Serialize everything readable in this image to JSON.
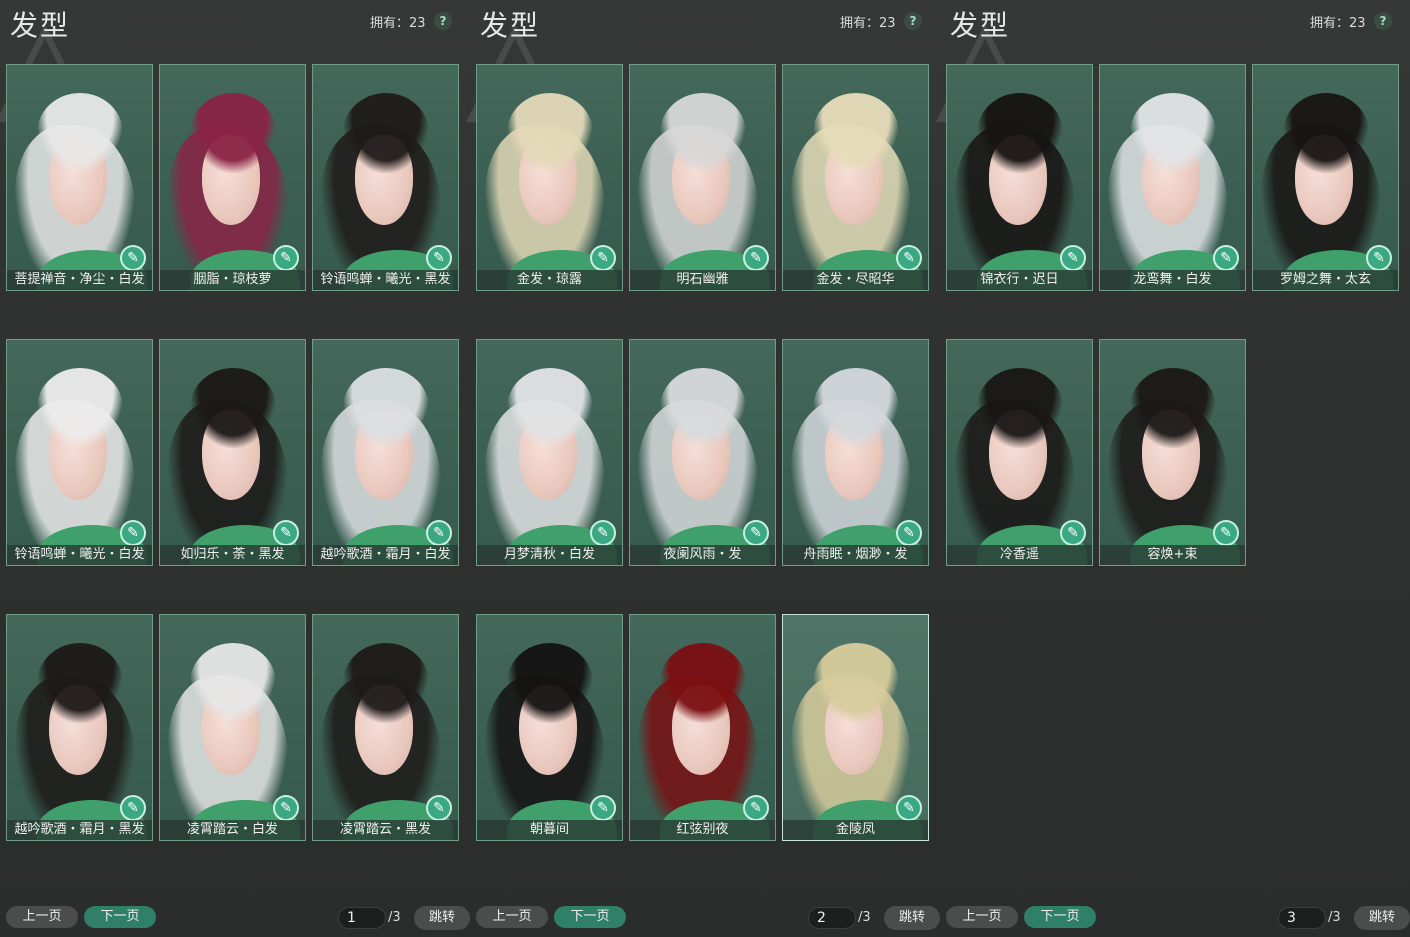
{
  "colors": {
    "card_bg": "#3f6357",
    "card_border": "#6e9d8a",
    "accent": "#2f8066",
    "dye_button": "#3aa882"
  },
  "panels": [
    {
      "title": "发型",
      "owned_label": "拥有：23",
      "help": "?",
      "items": [
        {
          "label": "菩提禅音・净尘・白发",
          "hair": "#e8e8e8",
          "selected": false
        },
        {
          "label": "胭脂・琼枝萝",
          "hair": "#8a2346",
          "selected": false
        },
        {
          "label": "铃语鸣蝉・曦光・黑发",
          "hair": "#1f1a1a",
          "selected": false
        },
        {
          "label": "铃语鸣蝉・曦光・白发",
          "hair": "#ececec",
          "selected": false
        },
        {
          "label": "如归乐・荼・黑发",
          "hair": "#1c1818",
          "selected": false
        },
        {
          "label": "越吟歌酒・霜月・白发",
          "hair": "#dcdfe2",
          "selected": false
        },
        {
          "label": "越吟歌酒・霜月・黑发",
          "hair": "#1d1919",
          "selected": false
        },
        {
          "label": "凌霄踏云・白发",
          "hair": "#e6e6e6",
          "selected": false
        },
        {
          "label": "凌霄踏云・黑发",
          "hair": "#1e1a1a",
          "selected": false
        }
      ],
      "prev_label": "上一页",
      "next_label": "下一页",
      "page": "1",
      "total": "/3",
      "jump_label": "跳转"
    },
    {
      "title": "发型",
      "owned_label": "拥有：23",
      "help": "?",
      "items": [
        {
          "label": "金发・琼露",
          "hair": "#e3d9b8",
          "selected": false
        },
        {
          "label": "明石幽雅",
          "hair": "#d8d8d8",
          "selected": false
        },
        {
          "label": "金发・尽昭华",
          "hair": "#e6dcb9",
          "selected": false
        },
        {
          "label": "月梦清秋・白发",
          "hair": "#e2e3e4",
          "selected": false
        },
        {
          "label": "夜阑风雨・发",
          "hair": "#d8dadc",
          "selected": false
        },
        {
          "label": "舟雨眠・烟渺・发",
          "hair": "#d4d8dc",
          "selected": false
        },
        {
          "label": "朝暮间",
          "hair": "#151212",
          "selected": false
        },
        {
          "label": "红弦别夜",
          "hair": "#7a0f12",
          "selected": false
        },
        {
          "label": "金陵凤",
          "hair": "#d8cc9c",
          "selected": true
        }
      ],
      "prev_label": "上一页",
      "next_label": "下一页",
      "page": "2",
      "total": "/3",
      "jump_label": "跳转"
    },
    {
      "title": "发型",
      "owned_label": "拥有：23",
      "help": "?",
      "items": [
        {
          "label": "锦衣行・迟日",
          "hair": "#171313",
          "selected": false
        },
        {
          "label": "龙鸾舞・白发",
          "hair": "#e2e4e6",
          "selected": false
        },
        {
          "label": "罗姆之舞・太玄",
          "hair": "#181414",
          "selected": false
        },
        {
          "label": "冷香遥",
          "hair": "#1a1616",
          "selected": false
        },
        {
          "label": "容焕+束",
          "hair": "#1c1818",
          "selected": false
        }
      ],
      "prev_label": "上一页",
      "next_label": "下一页",
      "page": "3",
      "total": "/3",
      "jump_label": "跳转"
    }
  ]
}
